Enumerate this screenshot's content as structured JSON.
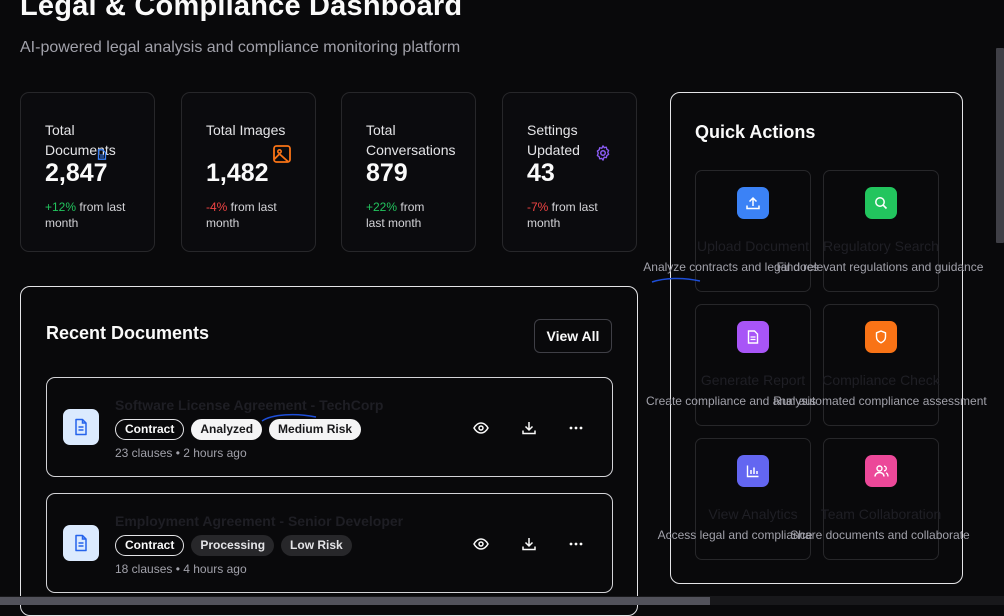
{
  "header": {
    "title": "Legal & Compliance Dashboard",
    "subtitle": "AI-powered legal analysis and compliance monitoring platform"
  },
  "stats": [
    {
      "label": "Total Documents",
      "value": "2,847",
      "change": "+12%",
      "change_suffix": " from last month",
      "trend": "positive",
      "icon": "document-icon",
      "icon_color": "#3b82f6"
    },
    {
      "label": "Total Images",
      "value": "1,482",
      "change": "-4%",
      "change_suffix": " from last month",
      "trend": "negative",
      "icon": "image-icon",
      "icon_color": "#f97316"
    },
    {
      "label": "Total Conversations",
      "value": "879",
      "change": "+22%",
      "change_suffix": " from last month",
      "trend": "positive",
      "icon": "chat-icon",
      "icon_color": "#22c55e"
    },
    {
      "label": "Settings Updated",
      "value": "43",
      "change": "-7%",
      "change_suffix": " from last month",
      "trend": "negative",
      "icon": "gear-icon",
      "icon_color": "#8b5cf6"
    }
  ],
  "recent": {
    "title": "Recent Documents",
    "view_all": "View All",
    "documents": [
      {
        "name": "Software License Agreement - TechCorp",
        "tags": [
          "Contract",
          "Analyzed",
          "Medium Risk"
        ],
        "meta": "23 clauses • 2 hours ago"
      },
      {
        "name": "Employment Agreement - Senior Developer",
        "tags": [
          "Contract",
          "Processing",
          "Low Risk"
        ],
        "meta": "18 clauses • 4 hours ago"
      }
    ]
  },
  "quick_actions": {
    "title": "Quick Actions",
    "items": [
      {
        "name": "Upload Document",
        "desc": "Analyze contracts and legal docs",
        "icon": "upload-icon",
        "color": "#3b82f6"
      },
      {
        "name": "Regulatory Search",
        "desc": "Find relevant regulations and guidance",
        "icon": "search-icon",
        "color": "#22c55e"
      },
      {
        "name": "Generate Report",
        "desc": "Create compliance and analysis",
        "icon": "report-icon",
        "color": "#a855f7"
      },
      {
        "name": "Compliance Check",
        "desc": "Run automated compliance assessment",
        "icon": "shield-icon",
        "color": "#f97316"
      },
      {
        "name": "View Analytics",
        "desc": "Access legal and compliance",
        "icon": "analytics-icon",
        "color": "#6366f1"
      },
      {
        "name": "Team Collaboration",
        "desc": "Share documents and collaborate",
        "icon": "users-icon",
        "color": "#ec4899"
      }
    ]
  }
}
